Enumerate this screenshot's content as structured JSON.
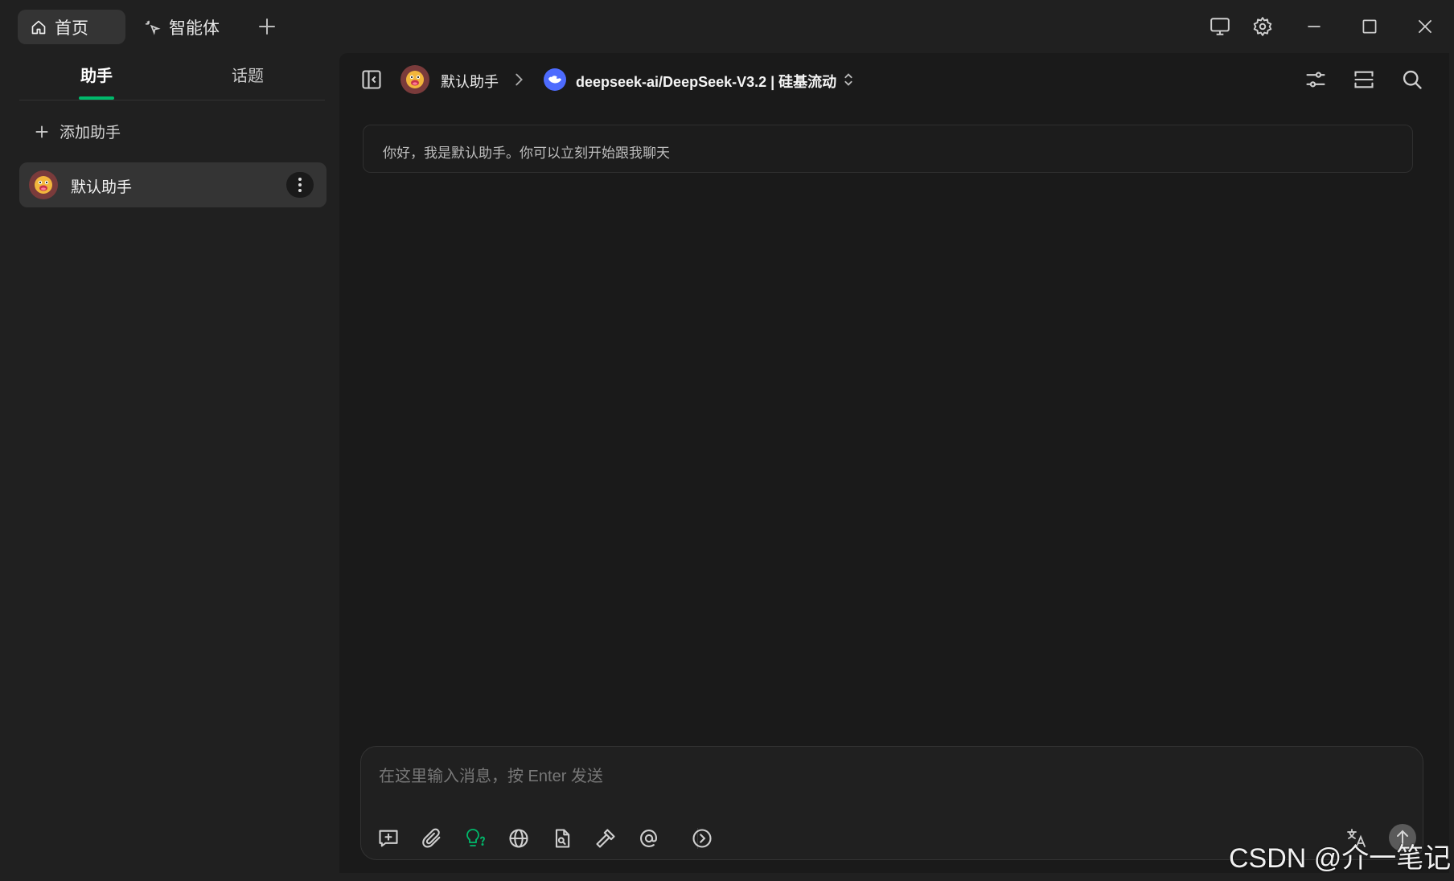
{
  "titlebar": {
    "tabs": [
      {
        "label": "首页",
        "icon": "home-icon",
        "active": true
      },
      {
        "label": "智能体",
        "icon": "sparkle-pointer-icon",
        "active": false
      }
    ],
    "add_tab_icon": "plus-icon",
    "window_controls": [
      "monitor-icon",
      "settings-gear-icon",
      "minimize-icon",
      "maximize-icon",
      "close-icon"
    ]
  },
  "sidebar": {
    "tabs": [
      {
        "label": "助手",
        "active": true
      },
      {
        "label": "话题",
        "active": false
      }
    ],
    "add_assistant_label": "添加助手",
    "assistants": [
      {
        "name": "默认助手",
        "avatar": "smiley-face-avatar"
      }
    ]
  },
  "main": {
    "breadcrumb": {
      "assistant_name": "默认助手",
      "model_name": "deepseek-ai/DeepSeek-V3.2 | 硅基流动"
    },
    "welcome_message": "你好，我是默认助手。你可以立刻开始跟我聊天",
    "composer": {
      "placeholder": "在这里输入消息，按 Enter 发送",
      "value": ""
    }
  },
  "watermark": "CSDN @介一笔记",
  "colors": {
    "accent": "#00b96b",
    "background": "#1a1a1a",
    "sidebar_bg": "#202020"
  }
}
